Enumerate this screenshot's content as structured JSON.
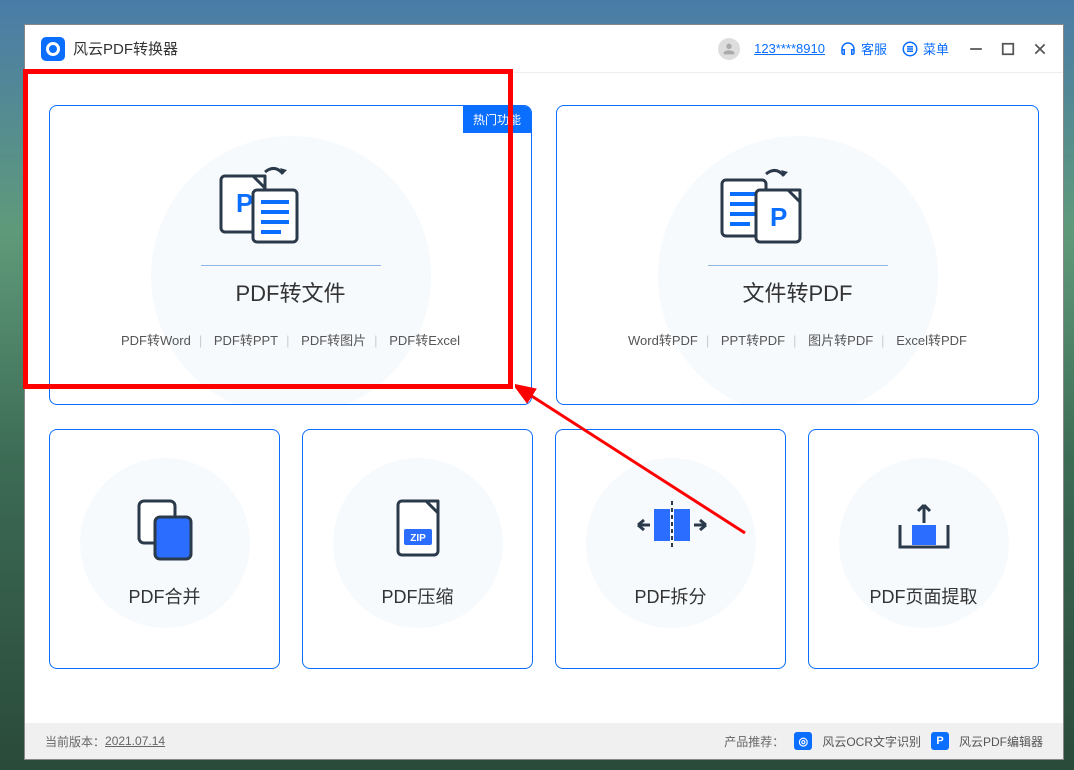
{
  "app": {
    "title": "风云PDF转换器"
  },
  "header": {
    "user_id": "123****8910",
    "support_label": "客服",
    "menu_label": "菜单"
  },
  "cards": {
    "pdf_to_file": {
      "hot_badge": "热门功能",
      "title": "PDF转文件",
      "subs": [
        "PDF转Word",
        "PDF转PPT",
        "PDF转图片",
        "PDF转Excel"
      ]
    },
    "file_to_pdf": {
      "title": "文件转PDF",
      "subs": [
        "Word转PDF",
        "PPT转PDF",
        "图片转PDF",
        "Excel转PDF"
      ]
    },
    "merge": {
      "title": "PDF合并"
    },
    "compress": {
      "title": "PDF压缩",
      "icon_label": "ZIP"
    },
    "split": {
      "title": "PDF拆分"
    },
    "extract": {
      "title": "PDF页面提取"
    }
  },
  "footer": {
    "version_label": "当前版本：",
    "version": "2021.07.14",
    "recommend_label": "产品推荐：",
    "ocr_label": "风云OCR文字识别",
    "editor_label": "风云PDF编辑器"
  }
}
